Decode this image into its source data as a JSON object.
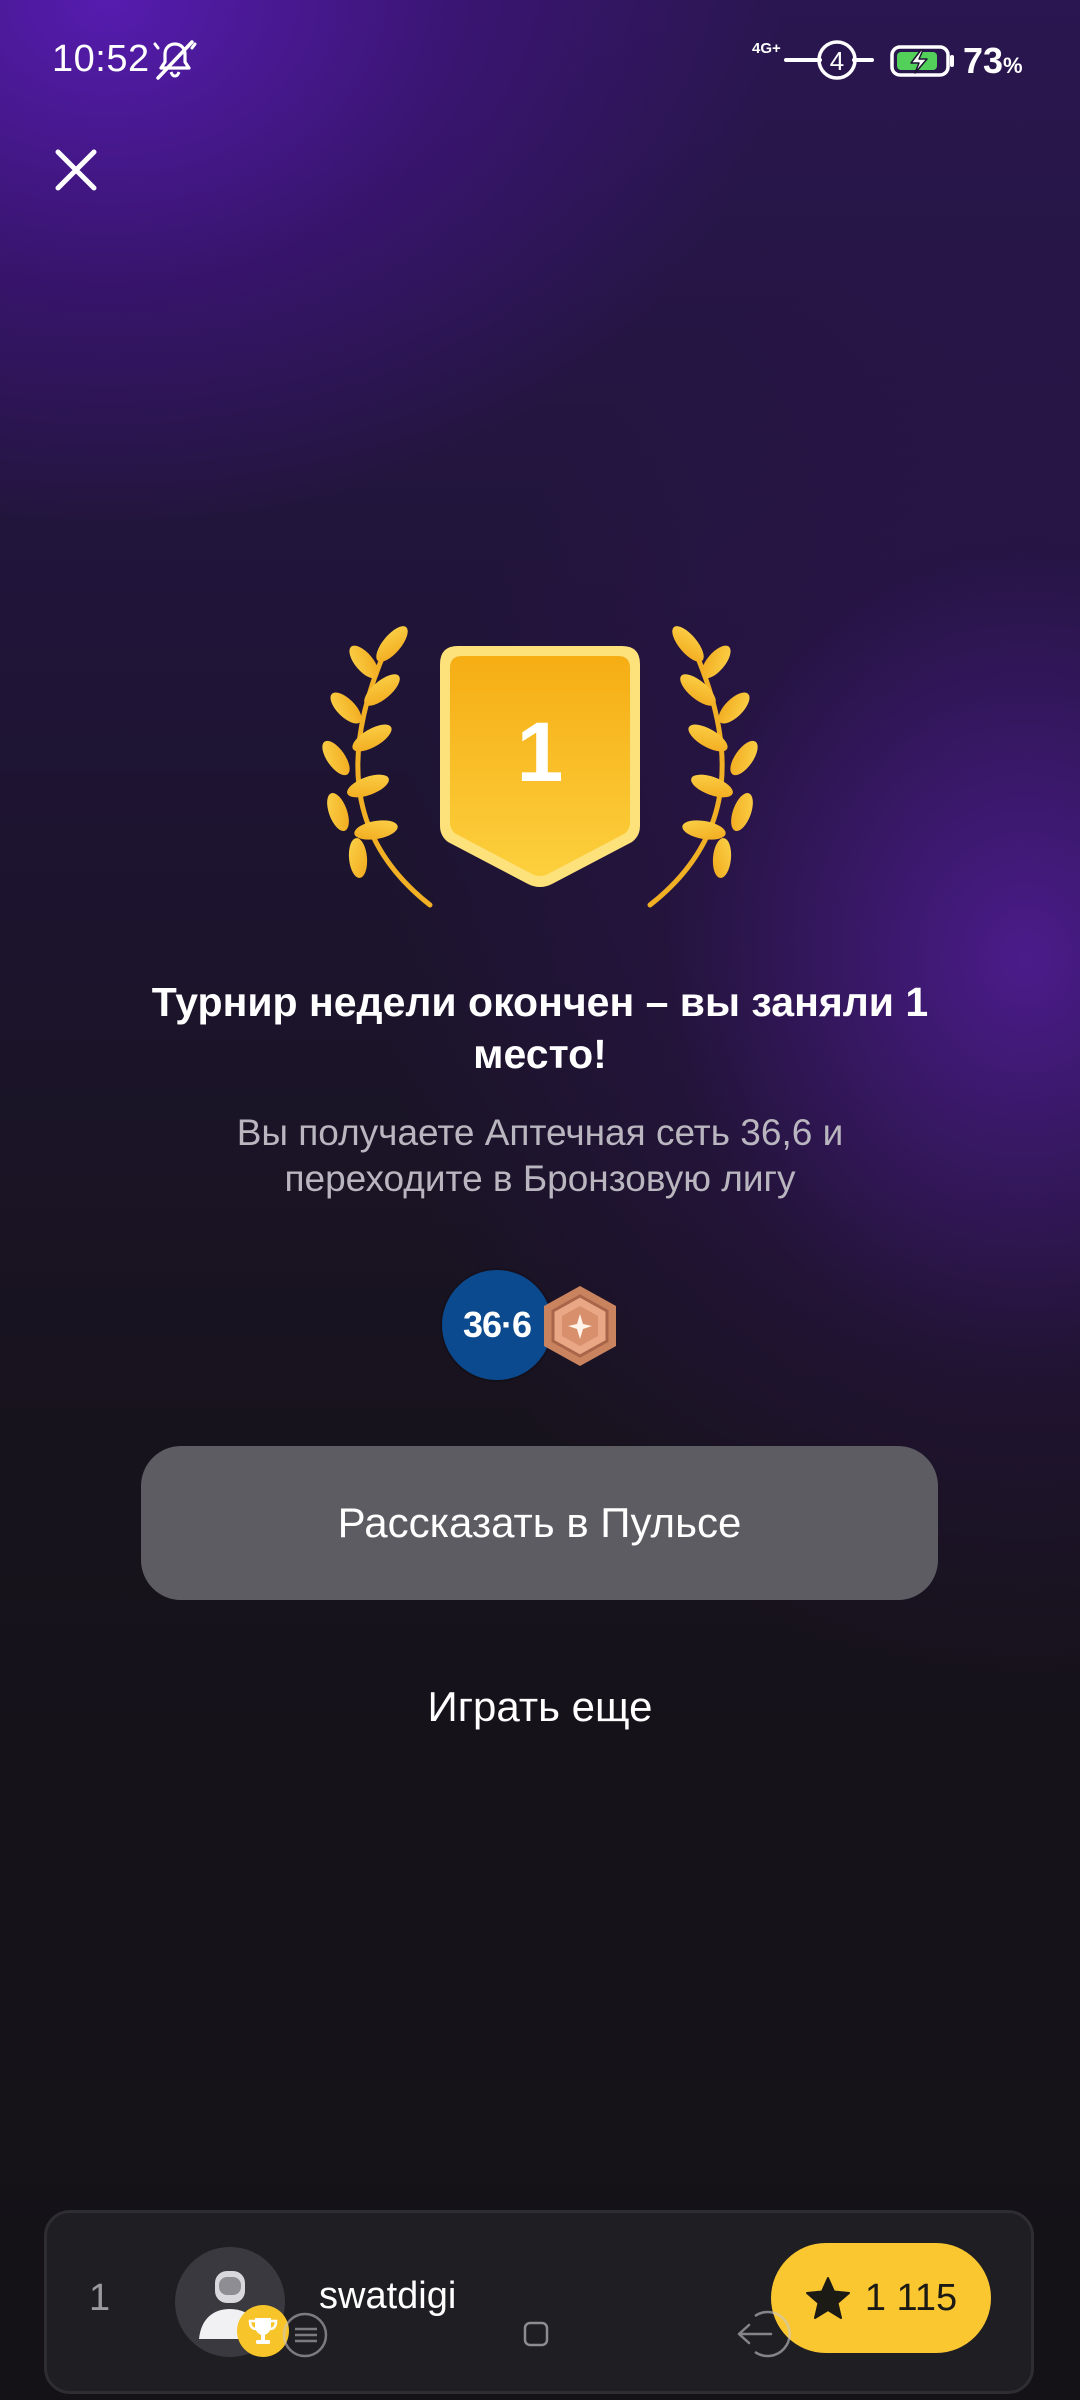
{
  "status_bar": {
    "time": "10:52",
    "network": "4G+",
    "sim_slot": "4",
    "battery_value": "73",
    "battery_unit": "%"
  },
  "icons": {
    "close": "close-icon",
    "mute": "bell-off-icon",
    "signal": "signal-icon",
    "battery": "battery-charging-icon",
    "laurel": "laurel-icon",
    "league": "bronze-league-icon",
    "star": "star-icon",
    "trophy": "trophy-icon"
  },
  "award": {
    "place": "1"
  },
  "result": {
    "title": "Турнир недели окончен – вы заняли 1 место!",
    "subtitle": "Вы получаете Аптечная сеть 36,6 и переходите в Бронзовую лигу"
  },
  "rewards": {
    "partner_logo_text": "36·6"
  },
  "actions": {
    "share_label": "Рассказать в Пульсе",
    "play_again_label": "Играть еще"
  },
  "player": {
    "rank": "1",
    "name": "swatdigi",
    "score": "1 115"
  },
  "colors": {
    "accent_gold": "#fbc731",
    "button_gray": "#5e5c63",
    "league_bronze": "#c9835f",
    "partner_blue": "#0b4a8e"
  }
}
